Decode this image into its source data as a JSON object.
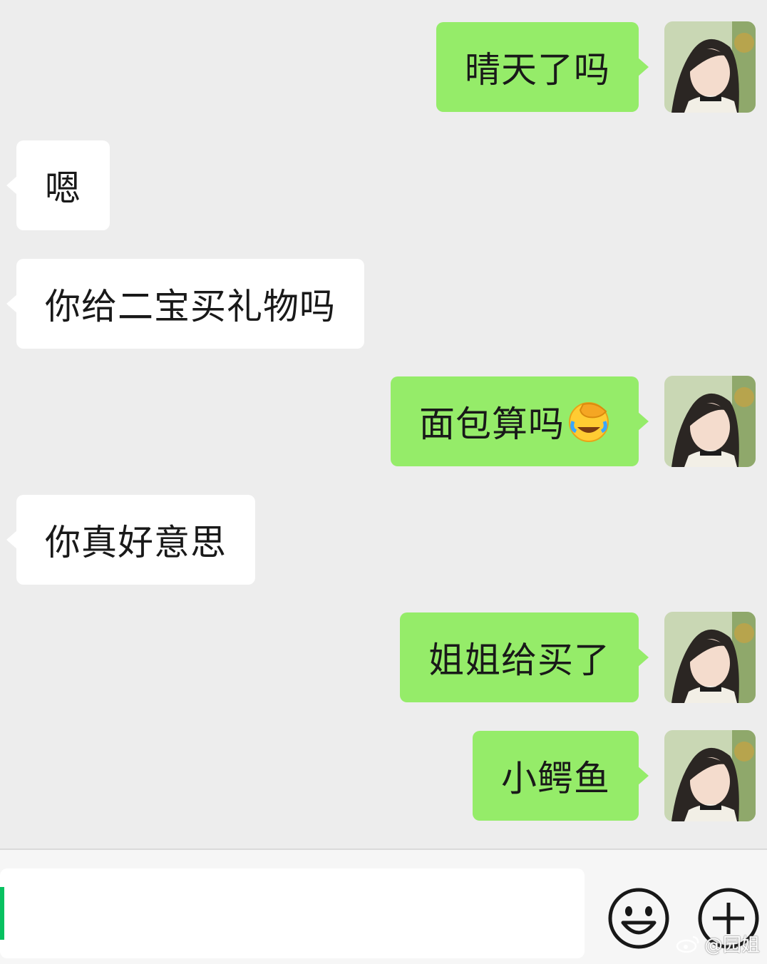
{
  "messages": [
    {
      "side": "right",
      "text": "晴天了吗"
    },
    {
      "side": "left",
      "text": "嗯"
    },
    {
      "side": "left",
      "text": "你给二宝买礼物吗"
    },
    {
      "side": "right",
      "text": "面包算吗",
      "emoji": "face-palm-laughing-emoji"
    },
    {
      "side": "left",
      "text": "你真好意思"
    },
    {
      "side": "right",
      "text": "姐姐给买了"
    },
    {
      "side": "right",
      "text": "小鳄鱼"
    }
  ],
  "input": {
    "value": ""
  },
  "icons": {
    "emoji_button": "smiley-icon",
    "more_button": "plus-circle-icon",
    "watermark_logo": "weibo-logo-icon"
  },
  "watermark": {
    "text": "@园姐"
  },
  "colors": {
    "sent_bubble": "#95ec69",
    "received_bubble": "#ffffff",
    "background": "#ededed",
    "cursor": "#07c160"
  }
}
